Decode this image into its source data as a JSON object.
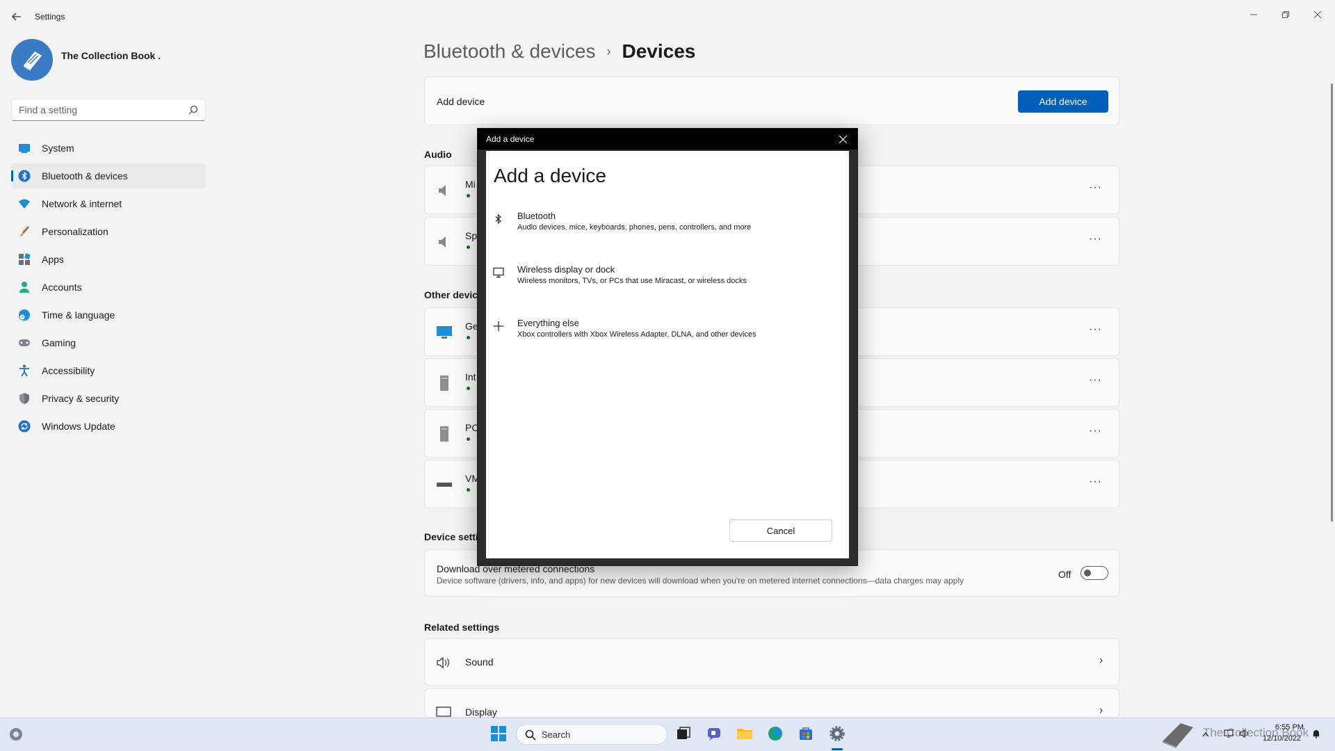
{
  "app": {
    "title": "Settings"
  },
  "profile": {
    "name": "The Collection Book ."
  },
  "search": {
    "placeholder": "Find a setting"
  },
  "nav": {
    "items": [
      {
        "label": "System"
      },
      {
        "label": "Bluetooth & devices"
      },
      {
        "label": "Network & internet"
      },
      {
        "label": "Personalization"
      },
      {
        "label": "Apps"
      },
      {
        "label": "Accounts"
      },
      {
        "label": "Time & language"
      },
      {
        "label": "Gaming"
      },
      {
        "label": "Accessibility"
      },
      {
        "label": "Privacy & security"
      },
      {
        "label": "Windows Update"
      }
    ]
  },
  "breadcrumb": {
    "parent": "Bluetooth & devices",
    "separator": "›",
    "current": "Devices"
  },
  "add_device_card": {
    "label": "Add device",
    "button": "Add device"
  },
  "sections": {
    "audio": "Audio",
    "other": "Other devic",
    "device_settings": "Device setti",
    "related": "Related settings"
  },
  "audio_devices": [
    {
      "name": "Mi"
    },
    {
      "name": "Sp"
    }
  ],
  "other_devices": [
    {
      "name": "Ge"
    },
    {
      "name": "Int"
    },
    {
      "name": "PC"
    },
    {
      "name": "VM"
    }
  ],
  "more_glyph": "···",
  "metered": {
    "title": "Download over metered connections",
    "description": "Device software (drivers, info, and apps) for new devices will download when you're on metered internet connections—data charges may apply",
    "toggle_label": "Off"
  },
  "related": [
    {
      "label": "Sound"
    },
    {
      "label": "Display"
    }
  ],
  "dialog": {
    "title": "Add a device",
    "heading": "Add a device",
    "options": [
      {
        "title": "Bluetooth",
        "desc": "Audio devices, mice, keyboards, phones, pens, controllers, and more"
      },
      {
        "title": "Wireless display or dock",
        "desc": "Wireless monitors, TVs, or PCs that use Miracast, or wireless docks"
      },
      {
        "title": "Everything else",
        "desc": "Xbox controllers with Xbox Wireless Adapter, DLNA, and other devices"
      }
    ],
    "cancel": "Cancel"
  },
  "taskbar": {
    "search_label": "Search",
    "watermark": "The Collection Book",
    "time": "6:55 PM",
    "date": "12/10/2022"
  },
  "colors": {
    "accent": "#005fb8",
    "dialog_frame": "#2b2b2b",
    "taskbar": "#dfe8f4"
  }
}
